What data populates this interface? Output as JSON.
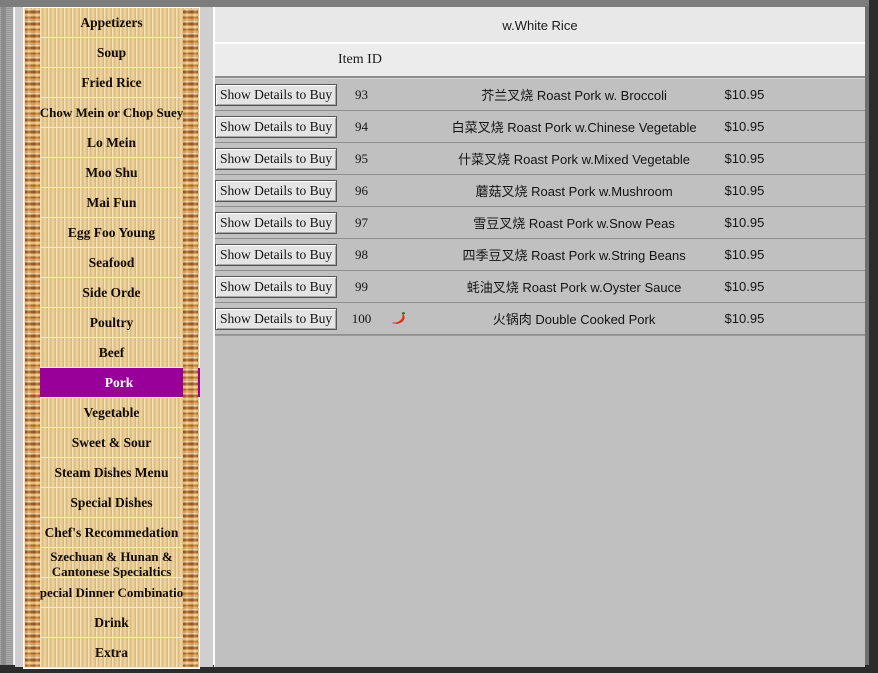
{
  "sidebar": {
    "items": [
      {
        "label": "Appetizers",
        "selected": false
      },
      {
        "label": "Soup",
        "selected": false
      },
      {
        "label": "Fried Rice",
        "selected": false
      },
      {
        "label": "Chow Mein or Chop Suey",
        "selected": false
      },
      {
        "label": "Lo Mein",
        "selected": false
      },
      {
        "label": "Moo Shu",
        "selected": false
      },
      {
        "label": "Mai Fun",
        "selected": false
      },
      {
        "label": "Egg Foo Young",
        "selected": false
      },
      {
        "label": "Seafood",
        "selected": false
      },
      {
        "label": "Side Orde",
        "selected": false
      },
      {
        "label": "Poultry",
        "selected": false
      },
      {
        "label": "Beef",
        "selected": false
      },
      {
        "label": "Pork",
        "selected": true
      },
      {
        "label": "Vegetable",
        "selected": false
      },
      {
        "label": "Sweet & Sour",
        "selected": false
      },
      {
        "label": "Steam Dishes Menu",
        "selected": false
      },
      {
        "label": "Special Dishes",
        "selected": false
      },
      {
        "label": "Chef's Recommedation",
        "selected": false
      },
      {
        "label": "Szechuan & Hunan & Cantonese Specialtics",
        "selected": false
      },
      {
        "label": "Special Dinner Combination",
        "selected": false
      },
      {
        "label": "Drink",
        "selected": false
      },
      {
        "label": "Extra",
        "selected": false
      }
    ],
    "selected_color": "#990099",
    "selected_text_color": "#ffffff"
  },
  "main": {
    "banner": "w.White Rice",
    "columns": {
      "item_id": "Item ID"
    },
    "button_label": "Show Details to Buy",
    "spicy_icon": "chili-pepper-icon",
    "rows": [
      {
        "id": "93",
        "spicy": false,
        "name": "芥兰叉烧 Roast Pork w. Broccoli",
        "price": "$10.95"
      },
      {
        "id": "94",
        "spicy": false,
        "name": "白菜叉烧 Roast Pork w.Chinese Vegetable",
        "price": "$10.95"
      },
      {
        "id": "95",
        "spicy": false,
        "name": "什菜叉烧 Roast Pork w.Mixed Vegetable",
        "price": "$10.95"
      },
      {
        "id": "96",
        "spicy": false,
        "name": "蘑菇叉烧 Roast Pork w.Mushroom",
        "price": "$10.95"
      },
      {
        "id": "97",
        "spicy": false,
        "name": "雪豆叉烧 Roast Pork w.Snow Peas",
        "price": "$10.95"
      },
      {
        "id": "98",
        "spicy": false,
        "name": "四季豆叉烧 Roast Pork w.String Beans",
        "price": "$10.95"
      },
      {
        "id": "99",
        "spicy": false,
        "name": "蚝油叉烧 Roast Pork w.Oyster Sauce",
        "price": "$10.95"
      },
      {
        "id": "100",
        "spicy": true,
        "name": "火锅肉 Double Cooked Pork",
        "price": "$10.95"
      }
    ]
  }
}
